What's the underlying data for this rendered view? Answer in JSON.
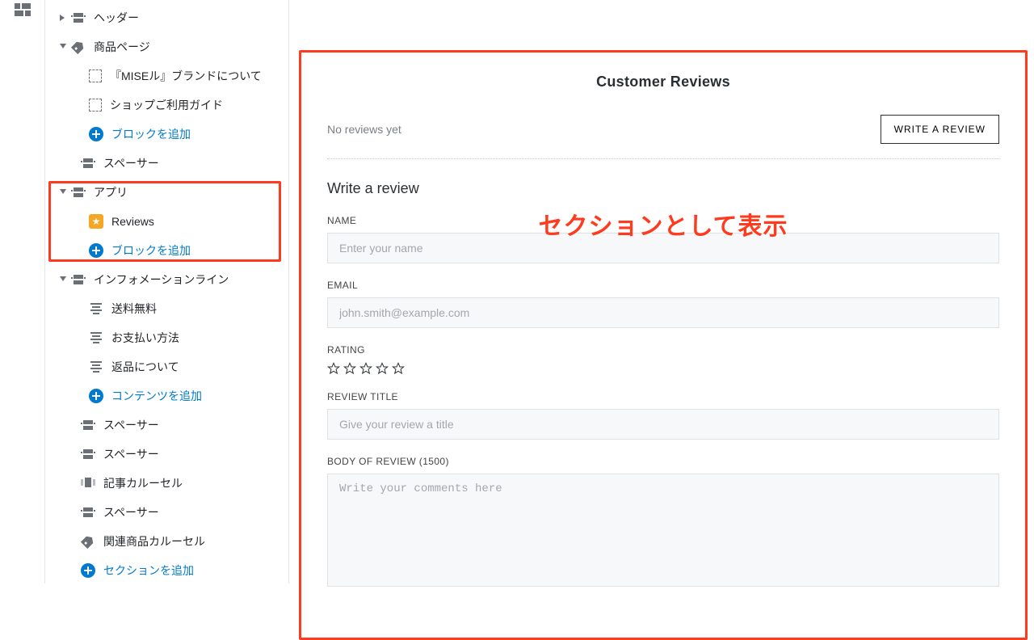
{
  "sidebar": {
    "header": {
      "label": "ヘッダー"
    },
    "product": {
      "label": "商品ページ"
    },
    "product_brand": {
      "label": "『MISEル』ブランドについて"
    },
    "product_guide": {
      "label": "ショップご利用ガイド"
    },
    "add_block": {
      "label": "ブロックを追加"
    },
    "spacer": {
      "label": "スペーサー"
    },
    "apps": {
      "label": "アプリ"
    },
    "apps_reviews": {
      "label": "Reviews"
    },
    "info_line": {
      "label": "インフォメーションライン"
    },
    "info_freeship": {
      "label": "送料無料"
    },
    "info_payment": {
      "label": "お支払い方法"
    },
    "info_return": {
      "label": "返品について"
    },
    "add_content": {
      "label": "コンテンツを追加"
    },
    "carousel": {
      "label": "記事カルーセル"
    },
    "related": {
      "label": "関連商品カルーセル"
    },
    "add_section": {
      "label": "セクションを追加"
    }
  },
  "preview": {
    "title": "Customer Reviews",
    "empty": "No reviews yet",
    "write_btn": "WRITE A REVIEW",
    "form_heading": "Write a review",
    "labels": {
      "name": "NAME",
      "email": "EMAIL",
      "rating": "RATING",
      "title": "REVIEW TITLE",
      "body": "BODY OF REVIEW (1500)"
    },
    "placeholders": {
      "name": "Enter your name",
      "email": "john.smith@example.com",
      "title": "Give your review a title",
      "body": "Write your comments here"
    }
  },
  "overlay": "セクションとして表示"
}
